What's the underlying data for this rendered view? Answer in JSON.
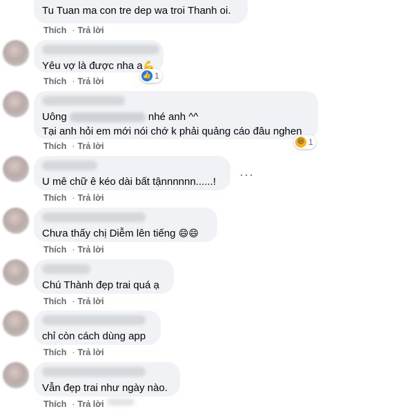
{
  "actions": {
    "like": "Thích",
    "reply": "Trả lời",
    "dot": "·"
  },
  "comments": [
    {
      "text": "Tu Tuan ma con tre dep wa troi Thanh oi."
    },
    {
      "text": "Yêu vợ là được nha a",
      "emoji": "💪",
      "reaction": {
        "type": "like-icon",
        "count": "1"
      }
    },
    {
      "text_before": "Uông",
      "text_after": "nhé anh ^^",
      "line2": "Tại anh hỏi em mới nói chớ k phải quảng cáo đâu nghen",
      "reaction": {
        "type": "haha-icon",
        "count": "1"
      }
    },
    {
      "text": "U mê chữ ê kéo dài bất tậnnnnnn......!",
      "more": "···"
    },
    {
      "text": "Chưa thấy chị Diễm lên tiếng",
      "emoji": "😄😄"
    },
    {
      "text": "Chú Thành đẹp trai quá ạ"
    },
    {
      "text": "chỉ còn cách dùng app"
    },
    {
      "text": "Vẫn đẹp trai như ngày nào."
    }
  ]
}
